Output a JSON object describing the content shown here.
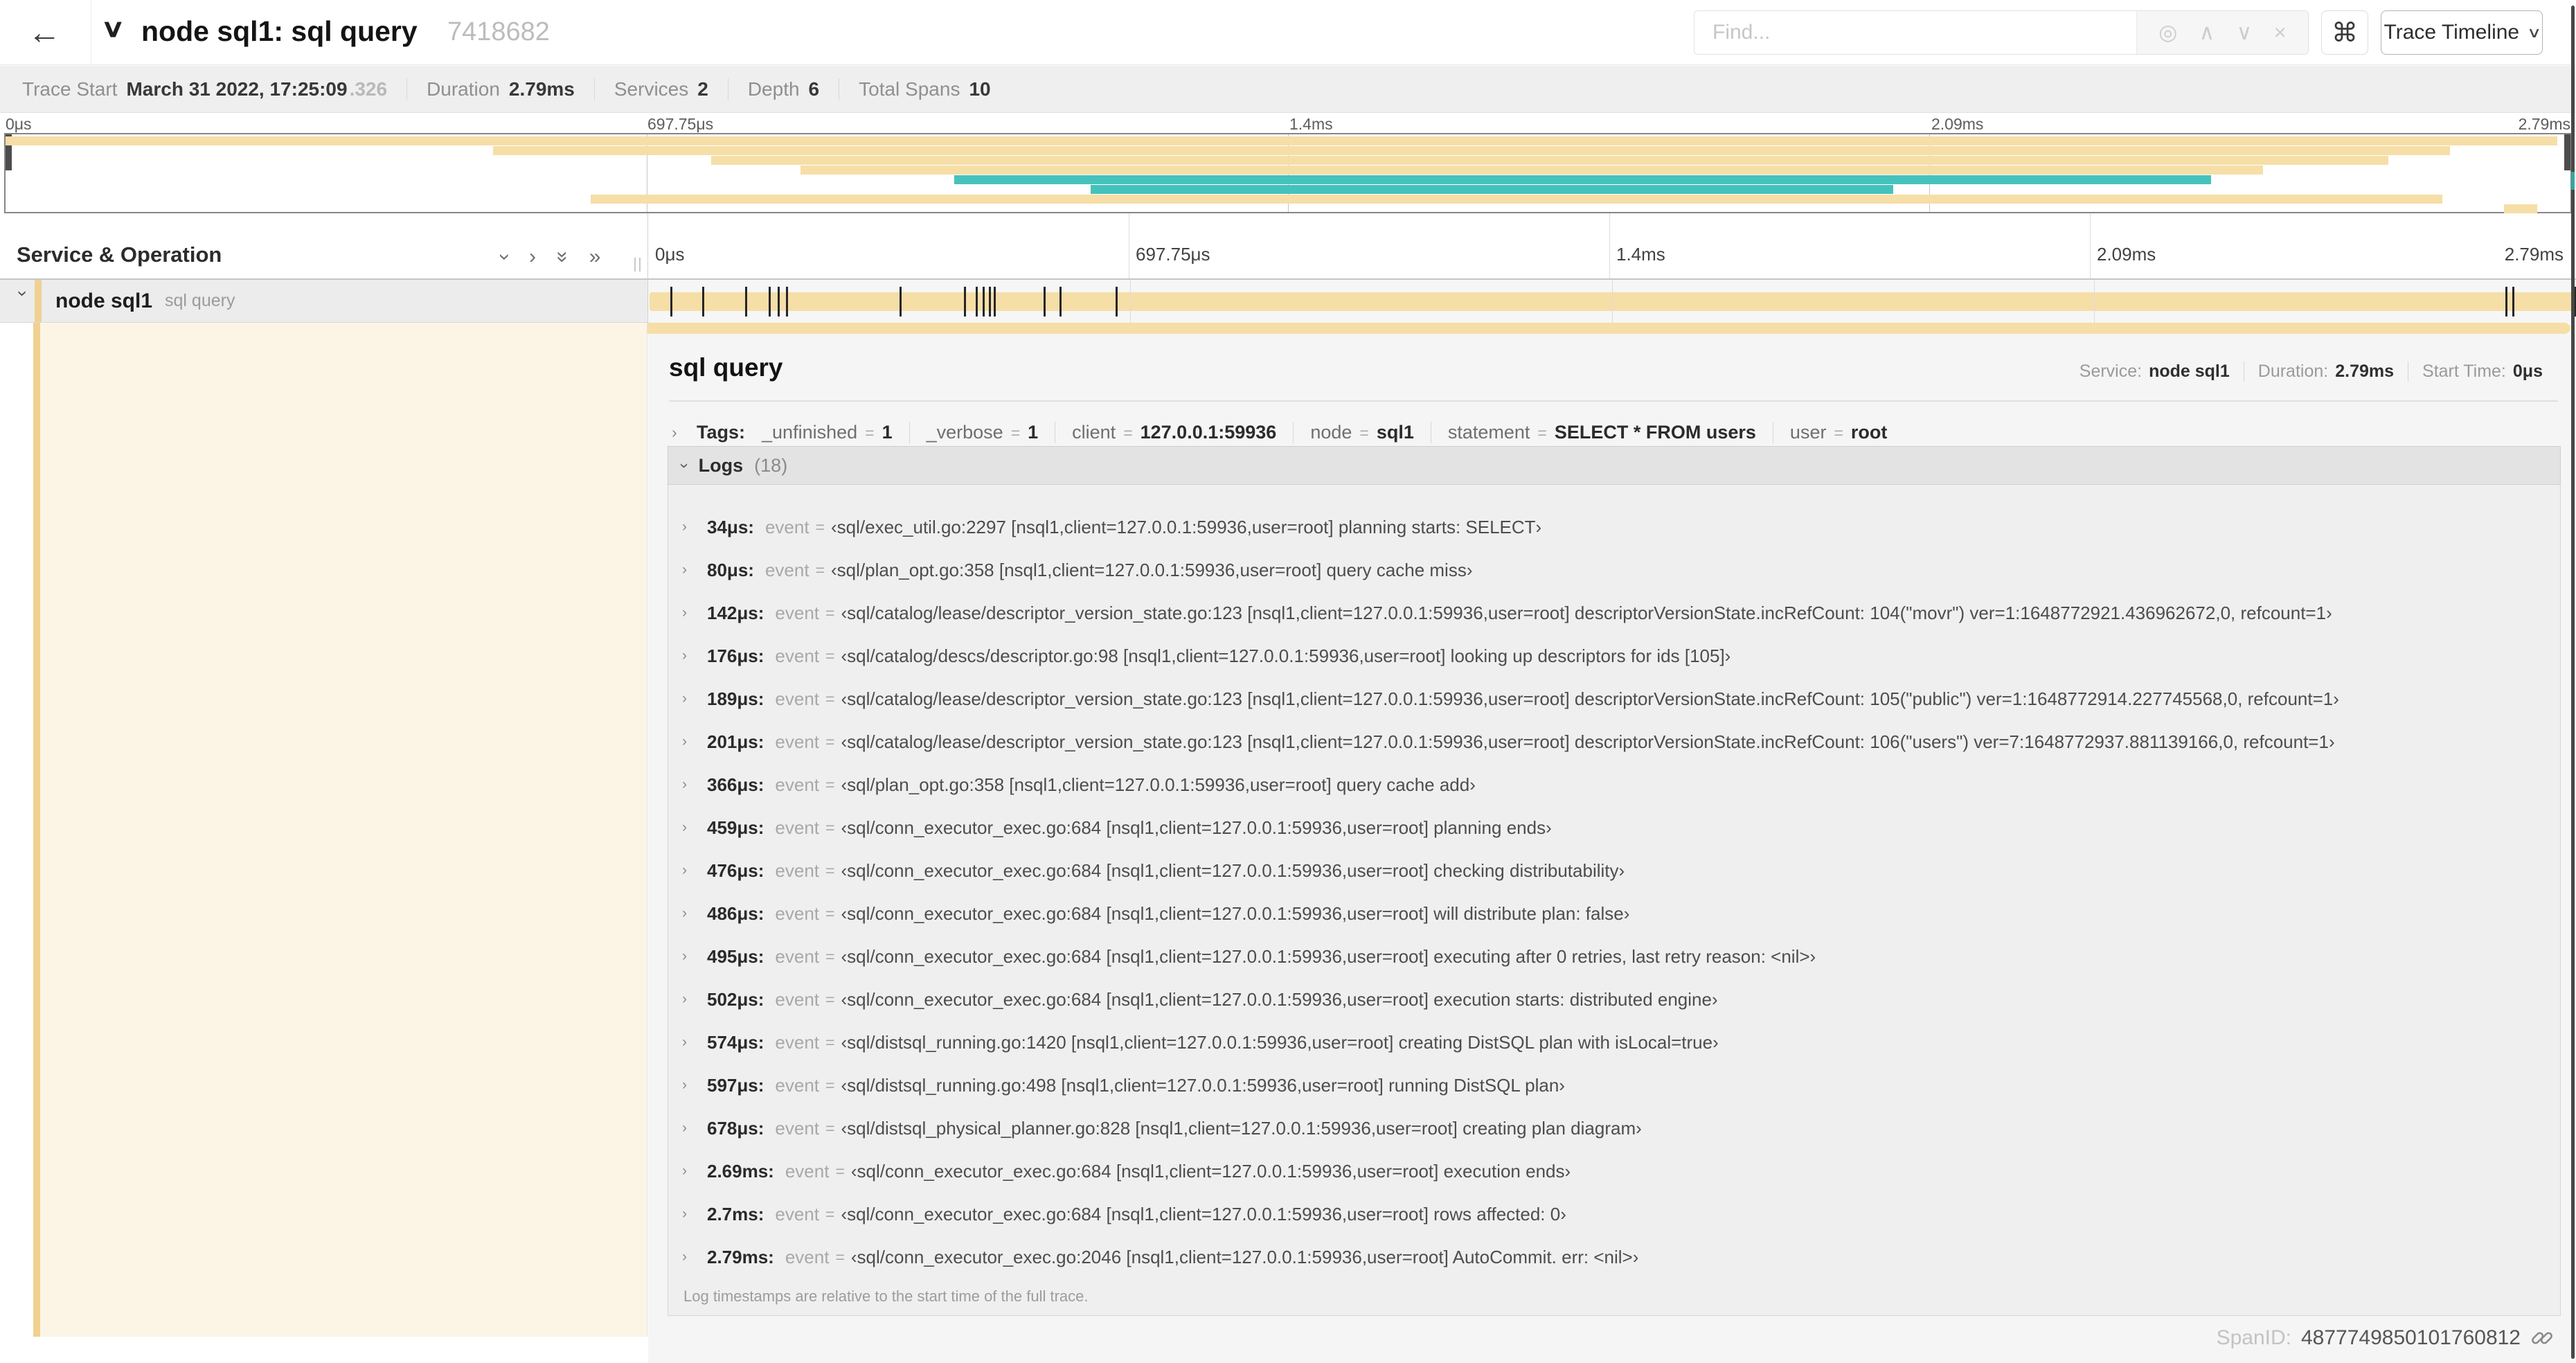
{
  "header": {
    "back_icon": "←",
    "collapse_icon": "∨",
    "title": "node sql1: sql query",
    "trace_id": "7418682",
    "find_placeholder": "Find...",
    "locate_icon": "◎",
    "prev_icon": "∧",
    "next_icon": "∨",
    "clear_icon": "×",
    "command_icon": "⌘",
    "view_selector_label": "Trace Timeline",
    "view_selector_caret": "∨"
  },
  "trace_meta": {
    "items": [
      {
        "label": "Trace Start",
        "value": "March 31 2022, 17:25:09",
        "extra": ".326"
      },
      {
        "label": "Duration",
        "value": "2.79ms"
      },
      {
        "label": "Services",
        "value": "2"
      },
      {
        "label": "Depth",
        "value": "6"
      },
      {
        "label": "Total Spans",
        "value": "10"
      }
    ]
  },
  "timeline": {
    "total_us": 2790,
    "ticks": [
      {
        "label": "0μs",
        "pct": 0
      },
      {
        "label": "697.75μs",
        "pct": 25
      },
      {
        "label": "1.4ms",
        "pct": 50
      },
      {
        "label": "2.09ms",
        "pct": 75
      },
      {
        "label": "2.79ms",
        "pct": 100
      }
    ],
    "colors": {
      "tan": "#f6dea7",
      "tan_dark": "#efd191",
      "teal": "#46c2bd"
    },
    "minimap_bars": [
      {
        "start": 0,
        "end": 99.5,
        "color": "tan"
      },
      {
        "start": 19,
        "end": 95.3,
        "color": "tan"
      },
      {
        "start": 27.5,
        "end": 92.9,
        "color": "tan"
      },
      {
        "start": 31,
        "end": 88,
        "color": "tan"
      },
      {
        "start": 37,
        "end": 86,
        "color": "teal"
      },
      {
        "start": 42.3,
        "end": 73.6,
        "color": "teal"
      },
      {
        "start": 22.8,
        "end": 95,
        "color": "tan"
      },
      {
        "start": 97.4,
        "end": 98.7,
        "color": "tan"
      }
    ]
  },
  "columns_header": {
    "label": "Service & Operation",
    "collapse_one_icon": "›",
    "expand_one_icon": "›",
    "collapse_all_icon": "»",
    "expand_all_icon": "»"
  },
  "span_row": {
    "caret": "›",
    "service": "node sql1",
    "operation": "sql query",
    "log_marker_times_us": [
      34,
      80,
      142,
      176,
      189,
      201,
      366,
      459,
      476,
      486,
      495,
      502,
      574,
      597,
      678,
      2690,
      2700,
      2790
    ]
  },
  "detail": {
    "title": "sql query",
    "meta": [
      {
        "label": "Service:",
        "value": "node sql1"
      },
      {
        "label": "Duration:",
        "value": "2.79ms"
      },
      {
        "label": "Start Time:",
        "value": "0μs"
      }
    ],
    "tags_caret": "›",
    "tags_label": "Tags:",
    "tags": [
      {
        "key": "_unfinished",
        "value": "1"
      },
      {
        "key": "_verbose",
        "value": "1"
      },
      {
        "key": "client",
        "value": "127.0.0.1:59936"
      },
      {
        "key": "node",
        "value": "sql1"
      },
      {
        "key": "statement",
        "value": "SELECT * FROM users"
      },
      {
        "key": "user",
        "value": "root"
      }
    ],
    "logs_caret": "›",
    "logs_label": "Logs",
    "logs_count": "(18)",
    "log_row_caret": "›",
    "log_field": "event",
    "logs": [
      {
        "time": "34μs:",
        "value": "‹sql/exec_util.go:2297 [nsql1,client=127.0.0.1:59936,user=root] planning starts: SELECT›"
      },
      {
        "time": "80μs:",
        "value": "‹sql/plan_opt.go:358 [nsql1,client=127.0.0.1:59936,user=root] query cache miss›"
      },
      {
        "time": "142μs:",
        "value": "‹sql/catalog/lease/descriptor_version_state.go:123 [nsql1,client=127.0.0.1:59936,user=root] descriptorVersionState.incRefCount: 104(\"movr\") ver=1:1648772921.436962672,0, refcount=1›"
      },
      {
        "time": "176μs:",
        "value": "‹sql/catalog/descs/descriptor.go:98 [nsql1,client=127.0.0.1:59936,user=root] looking up descriptors for ids [105]›"
      },
      {
        "time": "189μs:",
        "value": "‹sql/catalog/lease/descriptor_version_state.go:123 [nsql1,client=127.0.0.1:59936,user=root] descriptorVersionState.incRefCount: 105(\"public\") ver=1:1648772914.227745568,0, refcount=1›"
      },
      {
        "time": "201μs:",
        "value": "‹sql/catalog/lease/descriptor_version_state.go:123 [nsql1,client=127.0.0.1:59936,user=root] descriptorVersionState.incRefCount: 106(\"users\") ver=7:1648772937.881139166,0, refcount=1›"
      },
      {
        "time": "366μs:",
        "value": "‹sql/plan_opt.go:358 [nsql1,client=127.0.0.1:59936,user=root] query cache add›"
      },
      {
        "time": "459μs:",
        "value": "‹sql/conn_executor_exec.go:684 [nsql1,client=127.0.0.1:59936,user=root] planning ends›"
      },
      {
        "time": "476μs:",
        "value": "‹sql/conn_executor_exec.go:684 [nsql1,client=127.0.0.1:59936,user=root] checking distributability›"
      },
      {
        "time": "486μs:",
        "value": "‹sql/conn_executor_exec.go:684 [nsql1,client=127.0.0.1:59936,user=root] will distribute plan: false›"
      },
      {
        "time": "495μs:",
        "value": "‹sql/conn_executor_exec.go:684 [nsql1,client=127.0.0.1:59936,user=root] executing after 0 retries, last retry reason: <nil>›"
      },
      {
        "time": "502μs:",
        "value": "‹sql/conn_executor_exec.go:684 [nsql1,client=127.0.0.1:59936,user=root] execution starts: distributed engine›"
      },
      {
        "time": "574μs:",
        "value": "‹sql/distsql_running.go:1420 [nsql1,client=127.0.0.1:59936,user=root] creating DistSQL plan with isLocal=true›"
      },
      {
        "time": "597μs:",
        "value": "‹sql/distsql_running.go:498 [nsql1,client=127.0.0.1:59936,user=root] running DistSQL plan›"
      },
      {
        "time": "678μs:",
        "value": "‹sql/distsql_physical_planner.go:828 [nsql1,client=127.0.0.1:59936,user=root] creating plan diagram›"
      },
      {
        "time": "2.69ms:",
        "value": "‹sql/conn_executor_exec.go:684 [nsql1,client=127.0.0.1:59936,user=root] execution ends›"
      },
      {
        "time": "2.7ms:",
        "value": "‹sql/conn_executor_exec.go:684 [nsql1,client=127.0.0.1:59936,user=root] rows affected: 0›"
      },
      {
        "time": "2.79ms:",
        "value": "‹sql/conn_executor_exec.go:2046 [nsql1,client=127.0.0.1:59936,user=root] AutoCommit. err: <nil>›"
      }
    ],
    "logs_note": "Log timestamps are relative to the start time of the full trace.",
    "span_id_label": "SpanID:",
    "span_id_value": "4877749850101760812"
  }
}
